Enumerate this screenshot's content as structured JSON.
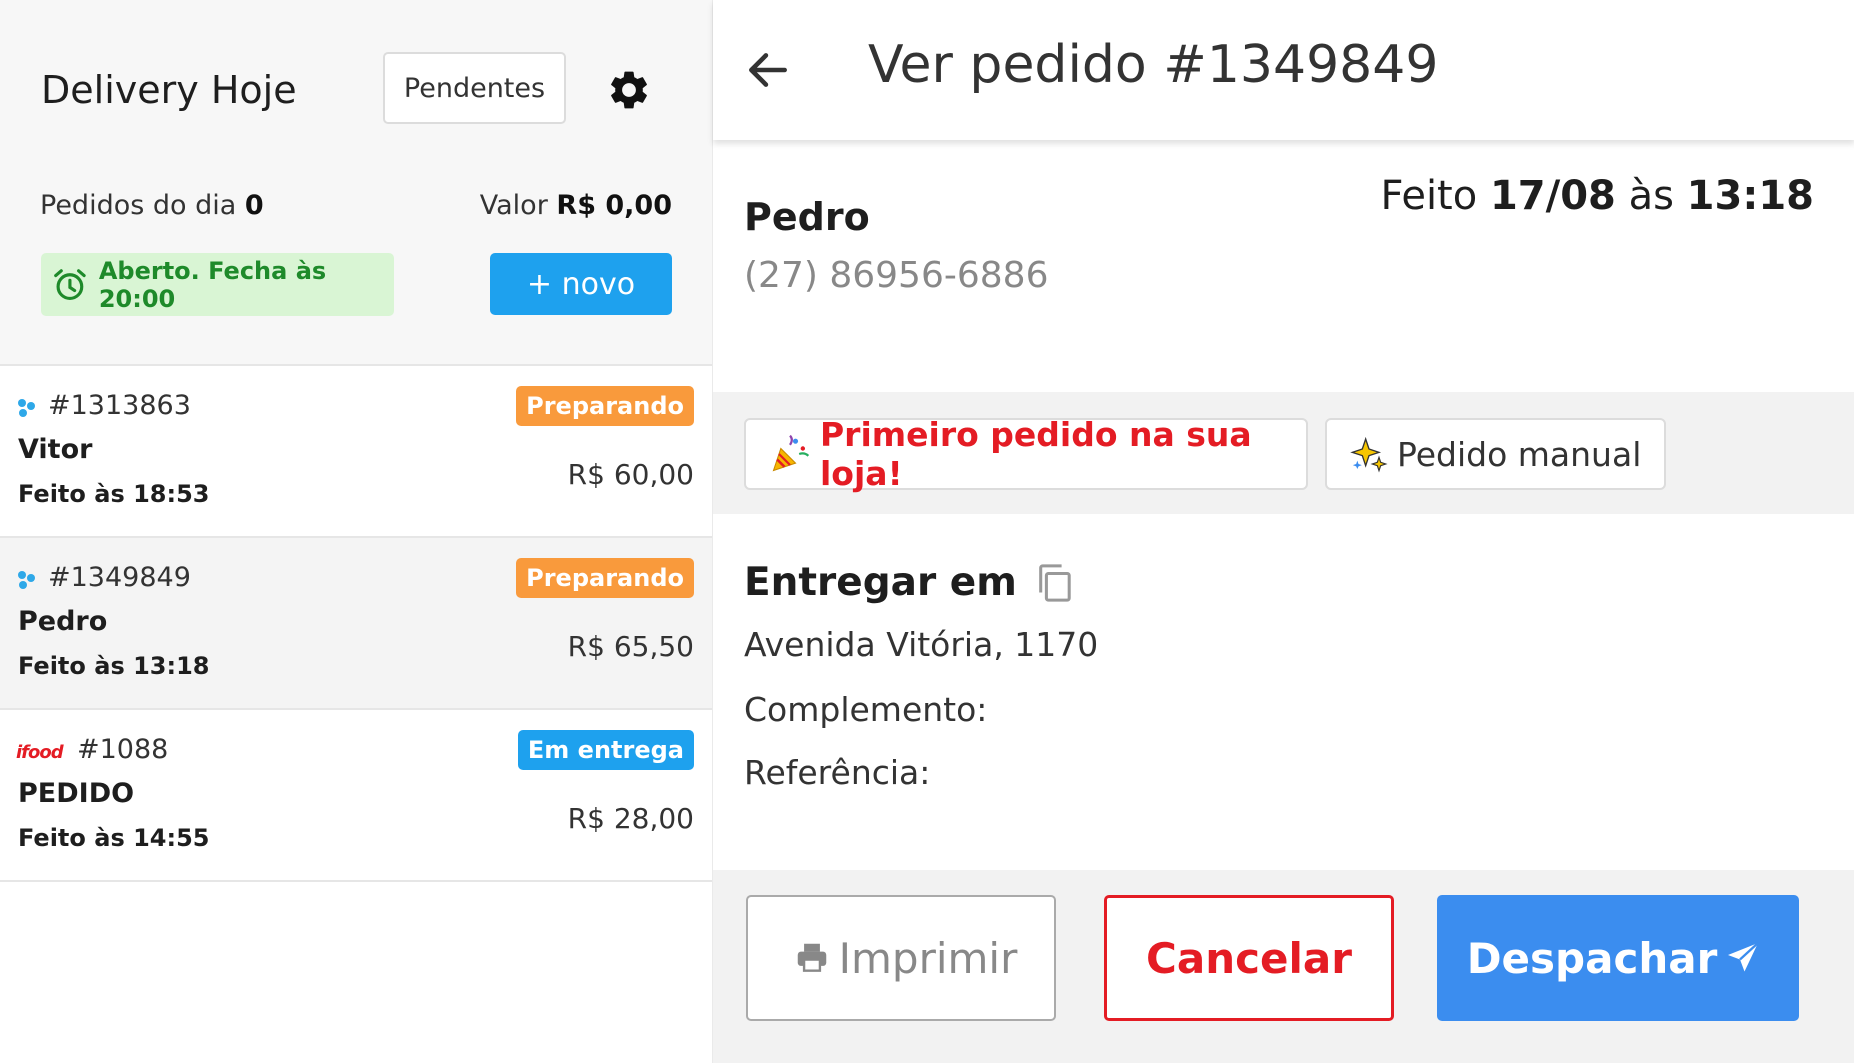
{
  "sidebar": {
    "title": "Delivery Hoje",
    "filter_label": "Pendentes",
    "orders_label": "Pedidos do dia",
    "orders_count": "0",
    "value_label": "Valor",
    "value_amount": "R$ 0,00",
    "status": "Aberto. Fecha às 20:00",
    "new_button": "+ novo",
    "orders": [
      {
        "source": "delivery-app",
        "number": "#1313863",
        "customer": "Vitor",
        "time": "Feito às 18:53",
        "status": "Preparando",
        "status_color": "#f99a3c",
        "price": "R$ 60,00"
      },
      {
        "source": "delivery-app",
        "number": "#1349849",
        "customer": "Pedro",
        "time": "Feito às 13:18",
        "status": "Preparando",
        "status_color": "#f99a3c",
        "price": "R$ 65,50"
      },
      {
        "source": "ifood",
        "source_label": "ifood",
        "number": "#1088",
        "customer": "PEDIDO",
        "time": "Feito às 14:55",
        "status": "Em entrega",
        "status_color": "#1ea1ee",
        "price": "R$ 28,00"
      }
    ]
  },
  "detail": {
    "title": "Ver pedido #1349849",
    "customer_name": "Pedro",
    "customer_phone": "(27) 86956-6886",
    "made_prefix": "Feito",
    "made_date": "17/08",
    "made_sep": "às",
    "made_time": "13:18",
    "tags": {
      "first_order": "Primeiro pedido na sua loja!",
      "manual": "Pedido manual"
    },
    "deliver_title": "Entregar em",
    "address": "Avenida Vitória, 1170",
    "complement": "Complemento:",
    "reference": "Referência:",
    "buttons": {
      "print": "Imprimir",
      "cancel": "Cancelar",
      "dispatch": "Despachar"
    }
  },
  "colors": {
    "accent_blue": "#1ea1ee",
    "dispatch_blue": "#3b8def",
    "danger_red": "#e41c24",
    "open_green": "#1e8a2a",
    "preparing_orange": "#f99a3c"
  }
}
